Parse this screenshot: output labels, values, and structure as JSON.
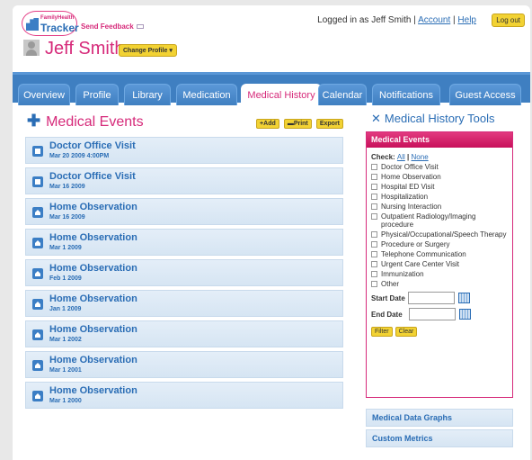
{
  "brand": {
    "line1": "FamilyHealth",
    "line2": "Tracker"
  },
  "header": {
    "feedback": "Send Feedback",
    "logged_in": "Logged in as Jeff Smith",
    "sep": "|",
    "account": "Account",
    "help": "Help",
    "logout": "Log out",
    "username": "Jeff Smith",
    "change_profile": "Change Profile"
  },
  "nav": {
    "tabs": [
      {
        "label": "Overview"
      },
      {
        "label": "Profile"
      },
      {
        "label": "Library"
      },
      {
        "label": "Medication"
      },
      {
        "label": "Medical History"
      },
      {
        "label": "Calendar"
      },
      {
        "label": "Notifications"
      },
      {
        "label": "Guest Access"
      }
    ]
  },
  "main": {
    "title": "Medical Events",
    "add": "Add",
    "print": "Print",
    "export": "Export",
    "events": [
      {
        "title": "Doctor Office Visit",
        "date": "Mar 20 2009 4:00PM"
      },
      {
        "title": "Doctor Office Visit",
        "date": "Mar 16 2009"
      },
      {
        "title": "Home Observation",
        "date": "Mar 16 2009"
      },
      {
        "title": "Home Observation",
        "date": "Mar 1 2009"
      },
      {
        "title": "Home Observation",
        "date": "Feb 1 2009"
      },
      {
        "title": "Home Observation",
        "date": "Jan 1 2009"
      },
      {
        "title": "Home Observation",
        "date": "Mar 1 2002"
      },
      {
        "title": "Home Observation",
        "date": "Mar 1 2001"
      },
      {
        "title": "Home Observation",
        "date": "Mar 1 2000"
      }
    ]
  },
  "tools": {
    "title": "Medical History Tools",
    "panel_title": "Medical Events",
    "check": "Check:",
    "all": "All",
    "sep": "|",
    "none": "None",
    "options": [
      "Doctor Office Visit",
      "Home Observation",
      "Hospital ED Visit",
      "Hospitalization",
      "Nursing Interaction",
      "Outpatient Radiology/Imaging procedure",
      "Physical/Occupational/Speech Therapy",
      "Procedure or Surgery",
      "Telephone Communication",
      "Urgent Care Center Visit",
      "Immunization",
      "Other"
    ],
    "start_date": "Start Date",
    "end_date": "End Date",
    "filter": "Filter",
    "clear": "Clear",
    "graphs": "Medical Data Graphs",
    "metrics": "Custom Metrics"
  }
}
